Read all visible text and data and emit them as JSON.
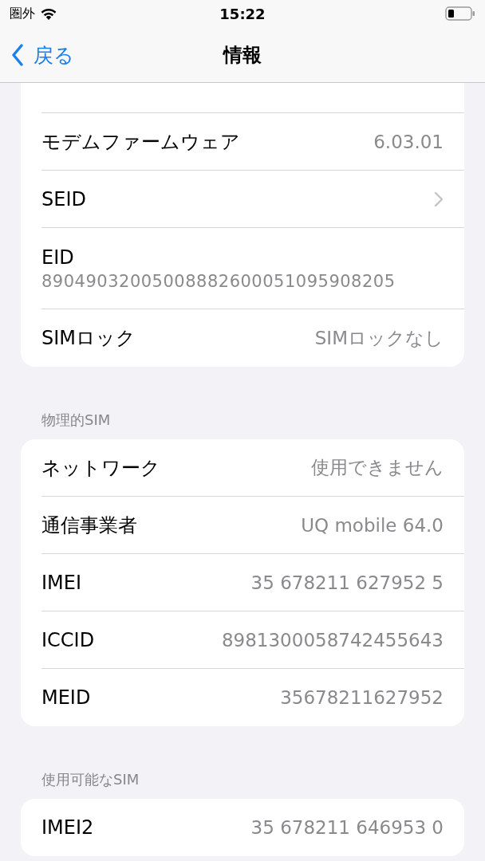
{
  "status_bar": {
    "carrier": "圏外",
    "time": "15:22"
  },
  "nav": {
    "back": "戻る",
    "title": "情報"
  },
  "sections": [
    {
      "rows": [
        {
          "kind": "value",
          "label": "モデムファームウェア",
          "value": "6.03.01"
        },
        {
          "kind": "chevron",
          "label": "SEID"
        },
        {
          "kind": "stacked",
          "label": "EID",
          "value": "89049032005008882600051095908205"
        },
        {
          "kind": "value",
          "label": "SIMロック",
          "value": "SIMロックなし"
        }
      ]
    },
    {
      "header": "物理的SIM",
      "rows": [
        {
          "kind": "value",
          "label": "ネットワーク",
          "value": "使用できません"
        },
        {
          "kind": "value",
          "label": "通信事業者",
          "value": "UQ mobile 64.0"
        },
        {
          "kind": "value",
          "label": "IMEI",
          "value": "35 678211 627952 5"
        },
        {
          "kind": "value",
          "label": "ICCID",
          "value": "8981300058742455643"
        },
        {
          "kind": "value",
          "label": "MEID",
          "value": "35678211627952"
        }
      ]
    },
    {
      "header": "使用可能なSIM",
      "rows": [
        {
          "kind": "value",
          "label": "IMEI2",
          "value": "35 678211 646953 0"
        }
      ]
    }
  ]
}
